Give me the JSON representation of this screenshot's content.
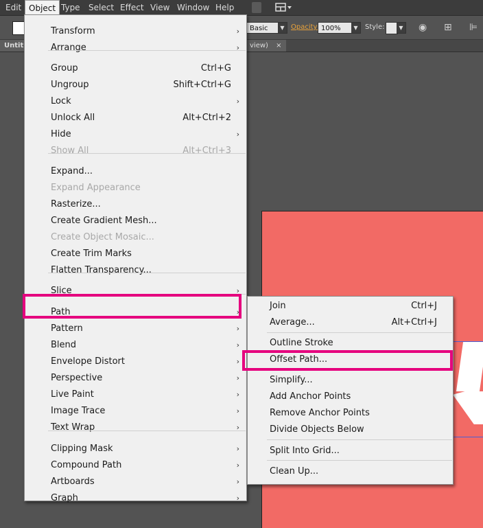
{
  "menubar": {
    "items": [
      "Edit",
      "Object",
      "Type",
      "Select",
      "Effect",
      "View",
      "Window",
      "Help"
    ],
    "active_index": 1
  },
  "control_bar": {
    "brush_label": "Basic",
    "opacity_label": "Opacity:",
    "opacity_value": "100%",
    "style_label": "Style:"
  },
  "tabs": {
    "first_label": "Untit",
    "second_label": "view)",
    "close_glyph": "×"
  },
  "object_menu": {
    "items": [
      {
        "label": "Transform",
        "shortcut": "",
        "submenu": true,
        "disabled": false
      },
      {
        "label": "Arrange",
        "shortcut": "",
        "submenu": true,
        "disabled": false
      },
      {
        "label": "Group",
        "shortcut": "Ctrl+G",
        "submenu": false,
        "disabled": false
      },
      {
        "label": "Ungroup",
        "shortcut": "Shift+Ctrl+G",
        "submenu": false,
        "disabled": false
      },
      {
        "label": "Lock",
        "shortcut": "",
        "submenu": true,
        "disabled": false
      },
      {
        "label": "Unlock All",
        "shortcut": "Alt+Ctrl+2",
        "submenu": false,
        "disabled": false
      },
      {
        "label": "Hide",
        "shortcut": "",
        "submenu": true,
        "disabled": false
      },
      {
        "label": "Show All",
        "shortcut": "Alt+Ctrl+3",
        "submenu": false,
        "disabled": true
      },
      {
        "label": "Expand...",
        "shortcut": "",
        "submenu": false,
        "disabled": false
      },
      {
        "label": "Expand Appearance",
        "shortcut": "",
        "submenu": false,
        "disabled": true
      },
      {
        "label": "Rasterize...",
        "shortcut": "",
        "submenu": false,
        "disabled": false
      },
      {
        "label": "Create Gradient Mesh...",
        "shortcut": "",
        "submenu": false,
        "disabled": false
      },
      {
        "label": "Create Object Mosaic...",
        "shortcut": "",
        "submenu": false,
        "disabled": true
      },
      {
        "label": "Create Trim Marks",
        "shortcut": "",
        "submenu": false,
        "disabled": false
      },
      {
        "label": "Flatten Transparency...",
        "shortcut": "",
        "submenu": false,
        "disabled": false
      },
      {
        "label": "Slice",
        "shortcut": "",
        "submenu": true,
        "disabled": false
      },
      {
        "label": "Path",
        "shortcut": "",
        "submenu": true,
        "disabled": false
      },
      {
        "label": "Pattern",
        "shortcut": "",
        "submenu": true,
        "disabled": false
      },
      {
        "label": "Blend",
        "shortcut": "",
        "submenu": true,
        "disabled": false
      },
      {
        "label": "Envelope Distort",
        "shortcut": "",
        "submenu": true,
        "disabled": false
      },
      {
        "label": "Perspective",
        "shortcut": "",
        "submenu": true,
        "disabled": false
      },
      {
        "label": "Live Paint",
        "shortcut": "",
        "submenu": true,
        "disabled": false
      },
      {
        "label": "Image Trace",
        "shortcut": "",
        "submenu": true,
        "disabled": false
      },
      {
        "label": "Text Wrap",
        "shortcut": "",
        "submenu": true,
        "disabled": false
      },
      {
        "label": "Clipping Mask",
        "shortcut": "",
        "submenu": true,
        "disabled": false
      },
      {
        "label": "Compound Path",
        "shortcut": "",
        "submenu": true,
        "disabled": false
      },
      {
        "label": "Artboards",
        "shortcut": "",
        "submenu": true,
        "disabled": false
      },
      {
        "label": "Graph",
        "shortcut": "",
        "submenu": true,
        "disabled": false
      }
    ],
    "arrow_glyph": "›"
  },
  "path_submenu": {
    "items": [
      {
        "label": "Join",
        "shortcut": "Ctrl+J"
      },
      {
        "label": "Average...",
        "shortcut": "Alt+Ctrl+J"
      },
      {
        "label": "Outline Stroke",
        "shortcut": ""
      },
      {
        "label": "Offset Path...",
        "shortcut": ""
      },
      {
        "label": "Simplify...",
        "shortcut": ""
      },
      {
        "label": "Add Anchor Points",
        "shortcut": ""
      },
      {
        "label": "Remove Anchor Points",
        "shortcut": ""
      },
      {
        "label": "Divide Objects Below",
        "shortcut": ""
      },
      {
        "label": "Split Into Grid...",
        "shortcut": ""
      },
      {
        "label": "Clean Up...",
        "shortcut": ""
      }
    ]
  },
  "colors": {
    "highlight": "#e5007e",
    "artboard": "#f26a65",
    "menu_bg": "#f0f0f0",
    "disabled_text": "#a8a8a8"
  }
}
